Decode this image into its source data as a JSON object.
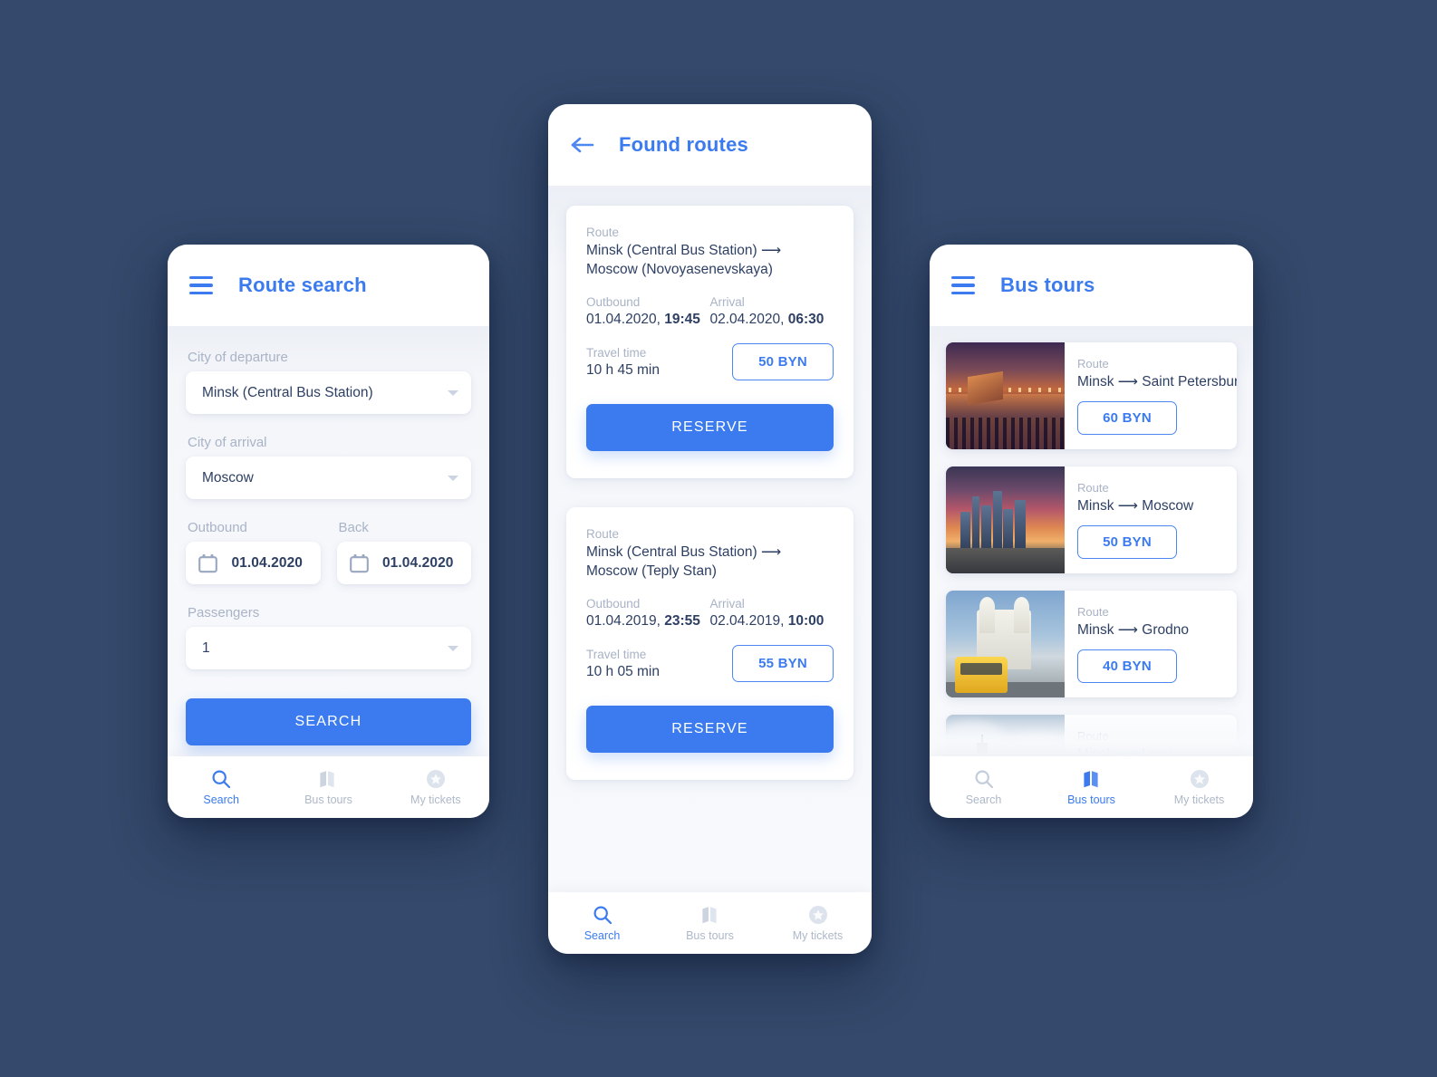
{
  "theme": {
    "background": "#34496b",
    "accent": "#3b7bef",
    "text_dark": "#2d3f63",
    "text_muted": "#a9b3c6"
  },
  "nav": {
    "items": [
      {
        "label": "Search",
        "icon": "search-icon"
      },
      {
        "label": "Bus tours",
        "icon": "map-icon"
      },
      {
        "label": "My tickets",
        "icon": "star-badge-icon"
      }
    ]
  },
  "screen_search": {
    "title": "Route search",
    "menu_icon": "hamburger-icon",
    "active_nav": "Search",
    "fields": {
      "departure_label": "City of departure",
      "departure_value": "Minsk (Central Bus Station)",
      "arrival_label": "City of arrival",
      "arrival_value": "Moscow",
      "outbound_label": "Outbound",
      "outbound_value": "01.04.2020",
      "back_label": "Back",
      "back_value": "01.04.2020",
      "passengers_label": "Passengers",
      "passengers_value": "1"
    },
    "search_button": "SEARCH"
  },
  "screen_routes": {
    "title": "Found routes",
    "back_icon": "arrow-left-icon",
    "active_nav": "Search",
    "labels": {
      "route": "Route",
      "outbound": "Outbound",
      "arrival": "Arrival",
      "travel_time": "Travel time"
    },
    "reserve_button": "RESERVE",
    "cards": [
      {
        "route": "Minsk (Central Bus Station) ⟶ Moscow (Novoyasenevskaya)",
        "outbound_date": "01.04.2020, ",
        "outbound_time": "19:45",
        "arrival_date": "02.04.2020, ",
        "arrival_time": "06:30",
        "travel_time": "10 h 45 min",
        "price": "50 BYN"
      },
      {
        "route": "Minsk (Central Bus Station) ⟶ Moscow (Teply Stan)",
        "outbound_date": "01.04.2019, ",
        "outbound_time": "23:55",
        "arrival_date": "02.04.2019, ",
        "arrival_time": "10:00",
        "travel_time": "10 h 05 min",
        "price": "55 BYN"
      }
    ]
  },
  "screen_tours": {
    "title": "Bus tours",
    "menu_icon": "hamburger-icon",
    "active_nav": "Bus tours",
    "route_label": "Route",
    "cards": [
      {
        "route": "Minsk ⟶ Saint Petersburg",
        "price": "60 BYN",
        "image": "saint-petersburg-bridge-night"
      },
      {
        "route": "Minsk ⟶ Moscow",
        "price": "50 BYN",
        "image": "moscow-city-skyline-sunset"
      },
      {
        "route": "Minsk ⟶ Grodno",
        "price": "40 BYN",
        "image": "grodno-cathedral-yellow-bus"
      },
      {
        "route": "Minsk ⟶ Lvov",
        "price": "",
        "image": "lvov-church-spire-clouds"
      }
    ]
  }
}
